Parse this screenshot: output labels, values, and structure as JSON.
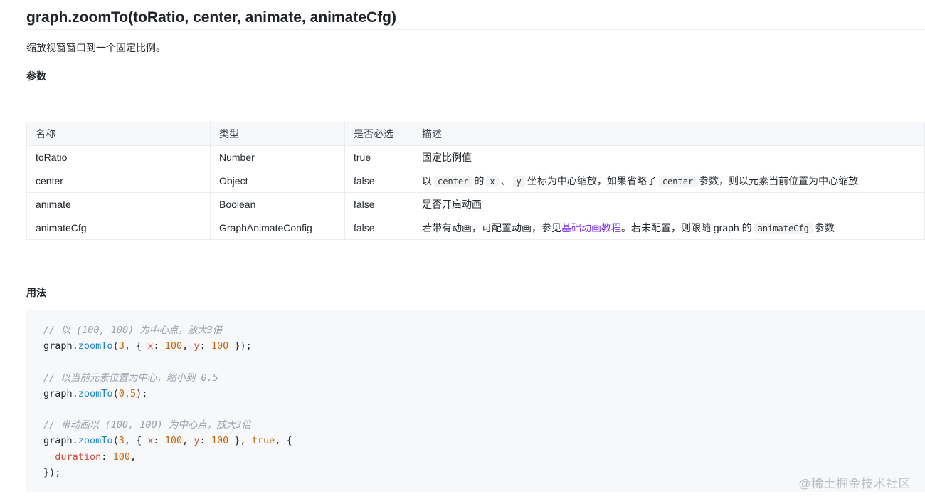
{
  "title": "graph.zoomTo(toRatio, center, animate, animateCfg)",
  "description": "缩放视窗窗口到一个固定比例。",
  "params_heading": "参数",
  "usage_heading": "用法",
  "table": {
    "headers": [
      "名称",
      "类型",
      "是否必选",
      "描述"
    ],
    "rows": [
      {
        "name": "toRatio",
        "type": "Number",
        "required": "true",
        "desc": "固定比例值"
      },
      {
        "name": "center",
        "type": "Object",
        "required": "false",
        "desc_parts": [
          "以",
          "center",
          "的",
          "x",
          "、",
          "y",
          "坐标为中心缩放，如果省略了",
          "center",
          "参数，则以元素当前位置为中心缩放"
        ]
      },
      {
        "name": "animate",
        "type": "Boolean",
        "required": "false",
        "desc": "是否开启动画"
      },
      {
        "name": "animateCfg",
        "type": "GraphAnimateConfig",
        "required": "false",
        "desc_parts": [
          "若带有动画，可配置动画，参见",
          "基础动画教程",
          "。若未配置，则跟随 graph 的",
          "animateCfg",
          "参数"
        ]
      }
    ]
  },
  "code": {
    "comment1": "// 以 (100, 100) 为中心点，放大3倍",
    "comment2": "// 以当前元素位置为中心，缩小到 0.5",
    "comment3": "// 带动画以 (100, 100) 为中心点，放大3倍",
    "obj": "graph",
    "fn": "zoomTo",
    "num3": "3",
    "num100": "100",
    "num05": "0.5",
    "key_x": "x",
    "key_y": "y",
    "bool_true": "true",
    "key_duration": "duration",
    "num_duration": "100"
  },
  "watermark": "@稀土掘金技术社区"
}
